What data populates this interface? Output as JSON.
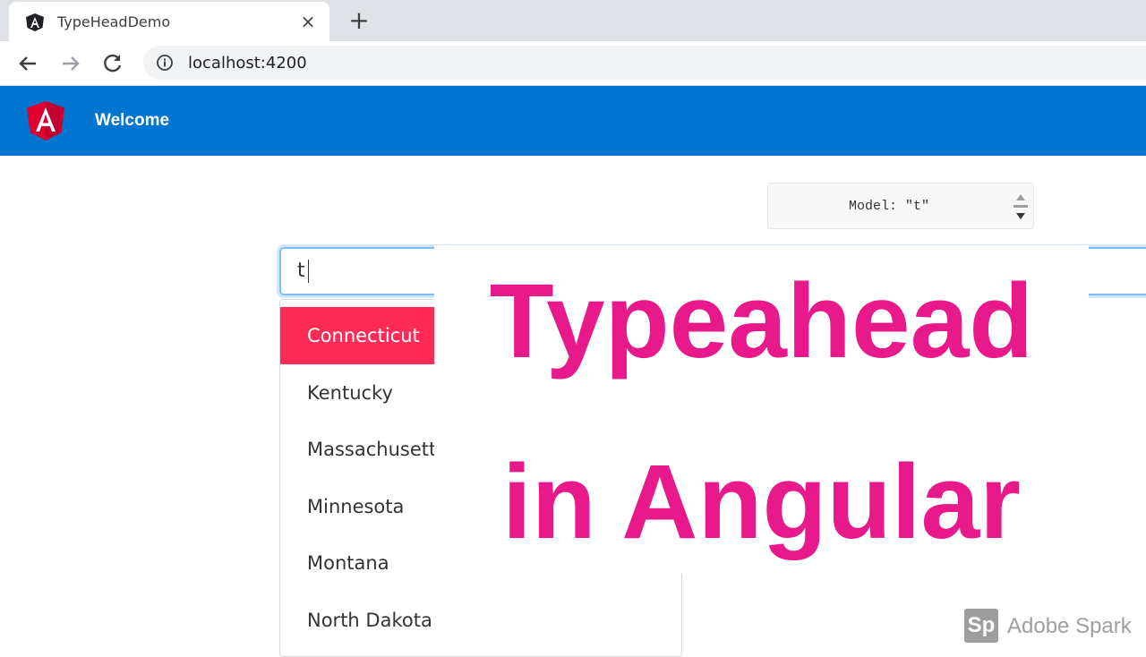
{
  "browser": {
    "tab_title": "TypeHeadDemo",
    "tab_close_glyph": "×",
    "new_tab_glyph": "+",
    "url": "localhost:4200",
    "icons": [
      "angular-favicon",
      "back-arrow",
      "forward-arrow",
      "reload",
      "info-icon"
    ]
  },
  "app": {
    "header_title": "Welcome",
    "header_color": "#0275d1",
    "logo": "angular-logo"
  },
  "model_box": {
    "text": "Model: \"t\""
  },
  "typeahead": {
    "value": "t",
    "options": [
      {
        "label": "Connecticut",
        "active": true
      },
      {
        "label": "Kentucky",
        "active": false
      },
      {
        "label": "Massachusetts",
        "active": false
      },
      {
        "label": "Minnesota",
        "active": false
      },
      {
        "label": "Montana",
        "active": false
      },
      {
        "label": "North Dakota",
        "active": false
      }
    ],
    "active_color": "#ff2a55"
  },
  "overlay": {
    "line1": "Typeahead",
    "line2": "in Angular",
    "color": "#e8198b"
  },
  "watermark": {
    "logo_text": "Sp",
    "text": "Adobe Spark"
  }
}
